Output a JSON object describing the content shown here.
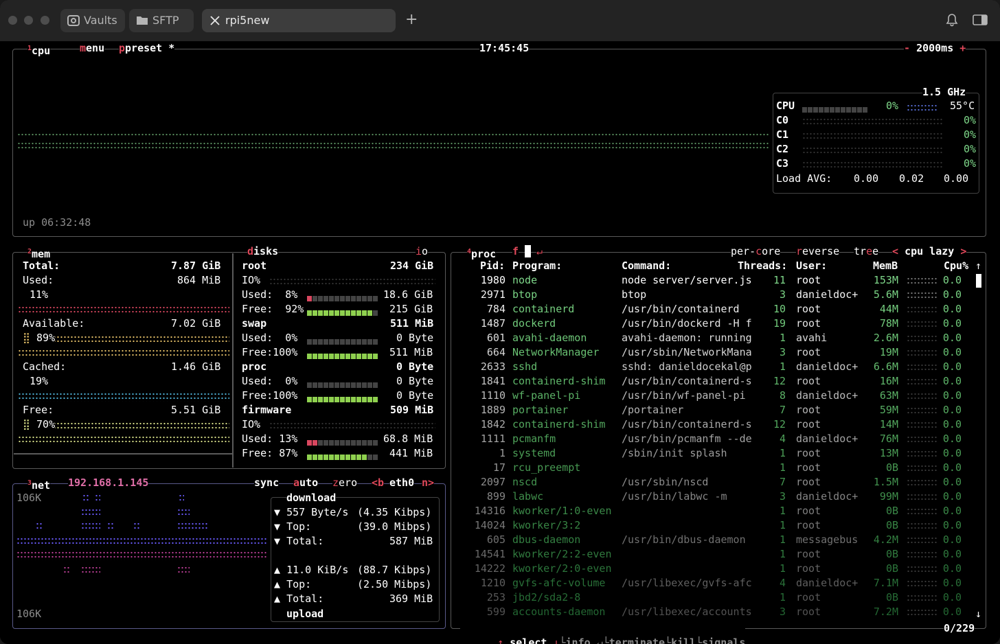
{
  "tabs": [
    {
      "label": "Vaults",
      "icon": "vault-icon"
    },
    {
      "label": "SFTP",
      "icon": "folder-icon"
    },
    {
      "label": "rpi5new",
      "icon": "close-icon"
    }
  ],
  "cpu": {
    "num": "1",
    "label": "cpu",
    "menu": "menu",
    "preset": "preset *",
    "time": "17:45:45",
    "interval": "2000ms",
    "minus": "-",
    "plus": "+",
    "freq": "1.5 GHz",
    "total_label": "CPU",
    "total_pct": "0%",
    "temp": "55°C",
    "cores": [
      {
        "name": "C0",
        "pct": "0%"
      },
      {
        "name": "C1",
        "pct": "0%"
      },
      {
        "name": "C2",
        "pct": "0%"
      },
      {
        "name": "C3",
        "pct": "0%"
      }
    ],
    "load_label": "Load AVG:",
    "load": [
      "0.00",
      "0.02",
      "0.00"
    ],
    "uptime": "up 06:32:48"
  },
  "mem": {
    "num": "2",
    "label": "mem",
    "total_label": "Total:",
    "total": "7.87 GiB",
    "used_label": "Used:",
    "used": "864 MiB",
    "used_pct": "11%",
    "used_level": 0.11,
    "avail_label": "Available:",
    "avail": "7.02 GiB",
    "avail_pct": "89%",
    "avail_level": 0.89,
    "cached_label": "Cached:",
    "cached": "1.46 GiB",
    "cached_pct": "19%",
    "cached_level": 0.19,
    "free_label": "Free:",
    "free": "5.51 GiB",
    "free_pct": "70%",
    "free_level": 0.7
  },
  "disks": {
    "label": "disks",
    "io": "io",
    "items": [
      {
        "name": "root",
        "size": "234 GiB",
        "io": "IO%",
        "used_pct": "8%",
        "used": "18.6 GiB",
        "used_level": 0.08,
        "free_pct": "92%",
        "free": "215 GiB",
        "free_level": 0.92
      },
      {
        "name": "swap",
        "size": "511 MiB",
        "used_pct": "0%",
        "used": "0 Byte",
        "used_level": 0.0,
        "free_pct": "100%",
        "free": "511 MiB",
        "free_level": 1.0
      },
      {
        "name": "proc",
        "size": "0 Byte",
        "used_pct": "0%",
        "used": "0 Byte",
        "used_level": 0.0,
        "free_pct": "100%",
        "free": "0 Byte",
        "free_level": 1.0
      },
      {
        "name": "firmware",
        "size": "509 MiB",
        "io": "IO%",
        "used_pct": "13%",
        "used": "68.8 MiB",
        "used_level": 0.13,
        "free_pct": "87%",
        "free": "441 MiB",
        "free_level": 0.87
      }
    ],
    "used_label": "Used:",
    "free_label": "Free:"
  },
  "net": {
    "num": "3",
    "label": "net",
    "ip": "192.168.1.145",
    "sync": "sync",
    "auto": "auto",
    "zero": "zero",
    "prev": "<b",
    "iface": "eth0",
    "next": "n>",
    "scale_top": "106K",
    "scale_bottom": "106K",
    "download_label": "download",
    "dl_rate": "557 Byte/s",
    "dl_kbps": "(4.35 Kibps)",
    "dl_top_label": "Top:",
    "dl_top": "(39.0 Mibps)",
    "dl_total_label": "Total:",
    "dl_total": "587 MiB",
    "ul_rate": "11.0 KiB/s",
    "ul_kbps": "(88.7 Kibps)",
    "ul_top_label": "Top:",
    "ul_top": "(2.50 Mibps)",
    "ul_total_label": "Total:",
    "ul_total": "369 MiB",
    "upload_label": "upload"
  },
  "proc": {
    "num": "4",
    "label": "proc",
    "filter": "f",
    "enter": "↵",
    "per_core": "per-core",
    "reverse": "reverse",
    "tree": "tree",
    "sort_prev": "<",
    "sort": "cpu lazy",
    "sort_next": ">",
    "headers": {
      "pid": "Pid:",
      "program": "Program:",
      "command": "Command:",
      "threads": "Threads:",
      "user": "User:",
      "memb": "MemB",
      "cpu": "Cpu%"
    },
    "rows": [
      {
        "pid": "1980",
        "program": "node",
        "command": "node server/server.js",
        "threads": "11",
        "user": "root",
        "mem": "153M",
        "cpu": "0.0"
      },
      {
        "pid": "2971",
        "program": "btop",
        "command": "btop",
        "threads": "3",
        "user": "danieldoc+",
        "mem": "5.6M",
        "cpu": "0.0"
      },
      {
        "pid": "784",
        "program": "containerd",
        "command": "/usr/bin/containerd",
        "threads": "10",
        "user": "root",
        "mem": "44M",
        "cpu": "0.0"
      },
      {
        "pid": "1487",
        "program": "dockerd",
        "command": "/usr/bin/dockerd -H f",
        "threads": "19",
        "user": "root",
        "mem": "78M",
        "cpu": "0.0"
      },
      {
        "pid": "601",
        "program": "avahi-daemon",
        "command": "avahi-daemon: running",
        "threads": "1",
        "user": "avahi",
        "mem": "2.6M",
        "cpu": "0.0"
      },
      {
        "pid": "664",
        "program": "NetworkManager",
        "command": "/usr/sbin/NetworkMana",
        "threads": "3",
        "user": "root",
        "mem": "19M",
        "cpu": "0.0"
      },
      {
        "pid": "2633",
        "program": "sshd",
        "command": "sshd: danieldocekal@p",
        "threads": "1",
        "user": "danieldoc+",
        "mem": "6.6M",
        "cpu": "0.0"
      },
      {
        "pid": "1841",
        "program": "containerd-shim",
        "command": "/usr/bin/containerd-s",
        "threads": "12",
        "user": "root",
        "mem": "16M",
        "cpu": "0.0"
      },
      {
        "pid": "1110",
        "program": "wf-panel-pi",
        "command": "/usr/bin/wf-panel-pi",
        "threads": "8",
        "user": "danieldoc+",
        "mem": "63M",
        "cpu": "0.0"
      },
      {
        "pid": "1889",
        "program": "portainer",
        "command": "/portainer",
        "threads": "7",
        "user": "root",
        "mem": "59M",
        "cpu": "0.0"
      },
      {
        "pid": "1842",
        "program": "containerd-shim",
        "command": "/usr/bin/containerd-s",
        "threads": "12",
        "user": "root",
        "mem": "14M",
        "cpu": "0.0"
      },
      {
        "pid": "1111",
        "program": "pcmanfm",
        "command": "/usr/bin/pcmanfm --de",
        "threads": "4",
        "user": "danieldoc+",
        "mem": "76M",
        "cpu": "0.0"
      },
      {
        "pid": "1",
        "program": "systemd",
        "command": "/sbin/init splash",
        "threads": "1",
        "user": "root",
        "mem": "13M",
        "cpu": "0.0"
      },
      {
        "pid": "17",
        "program": "rcu_preempt",
        "command": "",
        "threads": "1",
        "user": "root",
        "mem": "0B",
        "cpu": "0.0"
      },
      {
        "pid": "2097",
        "program": "nscd",
        "command": "/usr/sbin/nscd",
        "threads": "7",
        "user": "root",
        "mem": "1.5M",
        "cpu": "0.0"
      },
      {
        "pid": "899",
        "program": "labwc",
        "command": "/usr/bin/labwc -m",
        "threads": "3",
        "user": "danieldoc+",
        "mem": "99M",
        "cpu": "0.0"
      },
      {
        "pid": "14316",
        "program": "kworker/1:0-even",
        "command": "",
        "threads": "1",
        "user": "root",
        "mem": "0B",
        "cpu": "0.0"
      },
      {
        "pid": "14024",
        "program": "kworker/3:2",
        "command": "",
        "threads": "1",
        "user": "root",
        "mem": "0B",
        "cpu": "0.0"
      },
      {
        "pid": "605",
        "program": "dbus-daemon",
        "command": "/usr/bin/dbus-daemon",
        "threads": "1",
        "user": "messagebus",
        "mem": "4.2M",
        "cpu": "0.0"
      },
      {
        "pid": "14541",
        "program": "kworker/2:2-even",
        "command": "",
        "threads": "1",
        "user": "root",
        "mem": "0B",
        "cpu": "0.0"
      },
      {
        "pid": "14222",
        "program": "kworker/2:0-even",
        "command": "",
        "threads": "1",
        "user": "root",
        "mem": "0B",
        "cpu": "0.0"
      },
      {
        "pid": "1210",
        "program": "gvfs-afc-volume",
        "command": "/usr/libexec/gvfs-afc",
        "threads": "4",
        "user": "danieldoc+",
        "mem": "7.1M",
        "cpu": "0.0"
      },
      {
        "pid": "253",
        "program": "jbd2/sda2-8",
        "command": "",
        "threads": "1",
        "user": "root",
        "mem": "0B",
        "cpu": "0.0"
      },
      {
        "pid": "599",
        "program": "accounts-daemon",
        "command": "/usr/libexec/accounts",
        "threads": "3",
        "user": "root",
        "mem": "7.2M",
        "cpu": "0.0"
      }
    ],
    "footer": {
      "up": "↑",
      "select": "select",
      "down": "↓",
      "info": "info",
      "enter": "↵",
      "terminate": "terminate",
      "kill": "kill",
      "signals": "signals",
      "count": "0/229"
    }
  },
  "colors": {
    "accent": "#e0485a",
    "program": "#7fd88a",
    "mem_used": "#d9475f",
    "mem_avail": "#e9c46a",
    "mem_cached": "#4fb3d9",
    "mem_free": "#d9e08a",
    "net_dl": "#6b5cff",
    "net_ul": "#c0409a"
  }
}
